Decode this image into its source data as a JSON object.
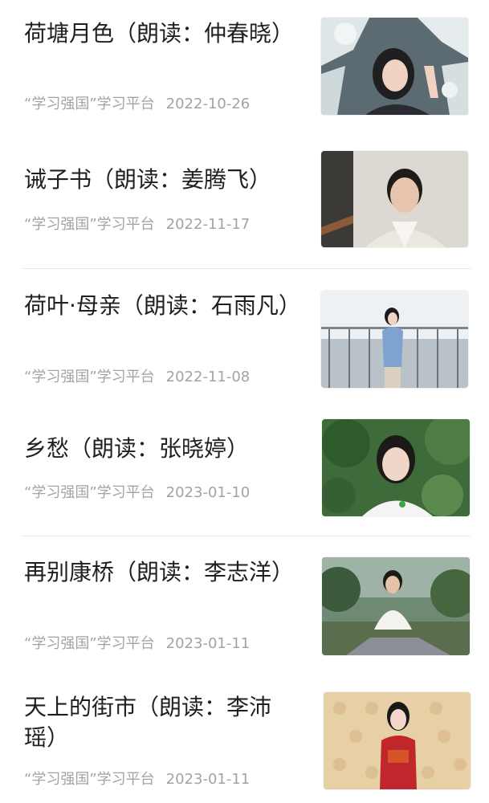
{
  "source_label": "“学习强国”学习平台",
  "articles": [
    {
      "title": "荷塘月色（朗读：仲春晓）",
      "date": "2022-10-26",
      "image": "reader-photo-snowy-trees"
    },
    {
      "title": "诫子书（朗读：姜腾飞）",
      "date": "2022-11-17",
      "image": "reader-photo-indoor-stairs"
    },
    {
      "title": "荷叶·母亲（朗读：石雨凡）",
      "date": "2022-11-08",
      "image": "reader-photo-balcony-city"
    },
    {
      "title": "乡愁（朗读：张晓婷）",
      "date": "2023-01-10",
      "image": "reader-photo-garden"
    },
    {
      "title": "再别康桥（朗读：李志洋）",
      "date": "2023-01-11",
      "image": "reader-photo-park-river"
    },
    {
      "title": "天上的街市（朗读：李沛瑶）",
      "date": "2023-01-11",
      "image": "reader-photo-red-dress-wall"
    }
  ]
}
